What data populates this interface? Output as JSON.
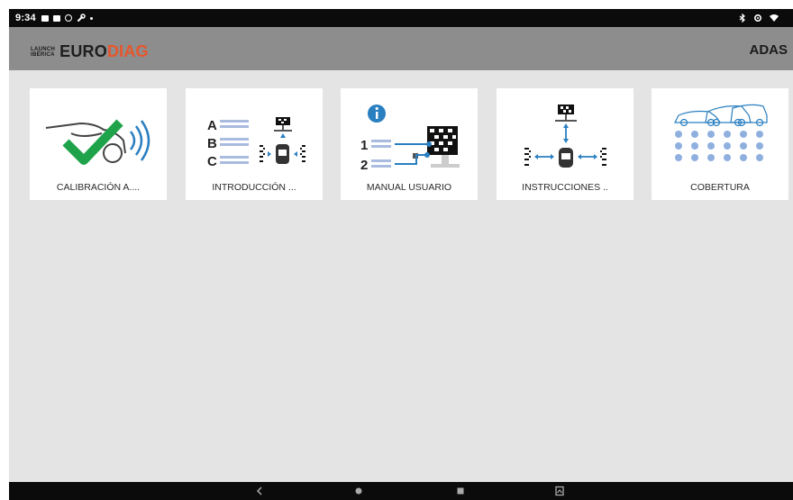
{
  "status_bar": {
    "time": "9:34",
    "left_icons": [
      "image-icon",
      "gallery-icon",
      "settings-icon",
      "wrench-icon",
      "dot-icon"
    ],
    "right_icons": [
      "bluetooth-icon",
      "location-icon",
      "wifi-icon"
    ]
  },
  "app_bar": {
    "logo_line1": "LAUNCH",
    "logo_line2": "IBÉRICA",
    "logo_brand_a": "EURO",
    "logo_brand_b": "DIAG",
    "title": "ADAS",
    "colors": {
      "bar": "#8d8d8d",
      "brand_accent": "#e8552b"
    }
  },
  "tiles": [
    {
      "label": "CALIBRACIÓN A....",
      "icon": "car-check-signal-icon"
    },
    {
      "label": "INTRODUCCIÓN ...",
      "icon": "abc-list-target-icon"
    },
    {
      "label": "MANUAL USUARIO",
      "icon": "info-manual-icon"
    },
    {
      "label": "INSTRUCCIONES ..",
      "icon": "instructions-layout-icon"
    },
    {
      "label": "COBERTURA",
      "icon": "vehicle-coverage-icon"
    }
  ],
  "colors": {
    "check_green": "#1ea34a",
    "accent_blue": "#2a7fc1",
    "light_blue": "#a9bbdf",
    "dot_blue": "#8fb0df"
  },
  "nav_bar": {
    "buttons": [
      "back-icon",
      "home-icon",
      "recents-icon",
      "screenshot-icon"
    ]
  }
}
